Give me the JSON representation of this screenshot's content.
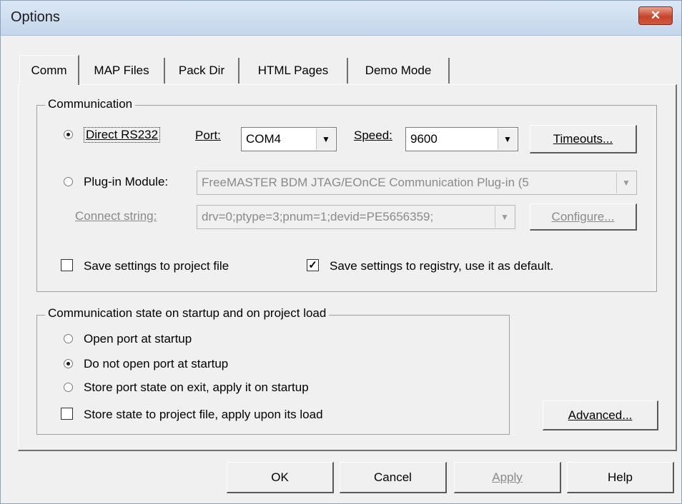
{
  "window": {
    "title": "Options",
    "close_symbol": "✕"
  },
  "tabs": [
    {
      "label": "Comm",
      "active": true
    },
    {
      "label": "MAP Files"
    },
    {
      "label": "Pack Dir"
    },
    {
      "label": "HTML Pages"
    },
    {
      "label": "Demo Mode"
    }
  ],
  "communication": {
    "group_label": "Communication",
    "direct_rs232": {
      "label": "Direct RS232",
      "selected": true
    },
    "port": {
      "label": "Port:",
      "value": "COM4"
    },
    "speed": {
      "label": "Speed:",
      "value": "9600"
    },
    "timeouts_button": "Timeouts...",
    "plugin_module": {
      "label": "Plug-in Module:",
      "selected": false,
      "value": "FreeMASTER BDM JTAG/EOnCE Communication Plug-in (5"
    },
    "connect_string": {
      "label": "Connect string:",
      "value": "drv=0;ptype=3;pnum=1;devid=PE5656359;"
    },
    "configure_button": "Configure...",
    "save_project": {
      "label": "Save settings to project file",
      "checked": false
    },
    "save_registry": {
      "label": "Save settings to registry, use it as default.",
      "checked": true
    }
  },
  "startup": {
    "group_label": "Communication state on startup and on project load",
    "options": [
      {
        "label": "Open port at startup",
        "selected": false
      },
      {
        "label": "Do not open port at startup",
        "selected": true
      },
      {
        "label": "Store port state on exit, apply it on startup",
        "selected": false
      }
    ],
    "store_state": {
      "label": "Store state to project file, apply upon its load",
      "checked": false
    }
  },
  "advanced_button": "Advanced...",
  "footer": {
    "ok": "OK",
    "cancel": "Cancel",
    "apply": "Apply",
    "help": "Help"
  },
  "icons": {
    "dropdown": "▼",
    "check": "✓"
  }
}
